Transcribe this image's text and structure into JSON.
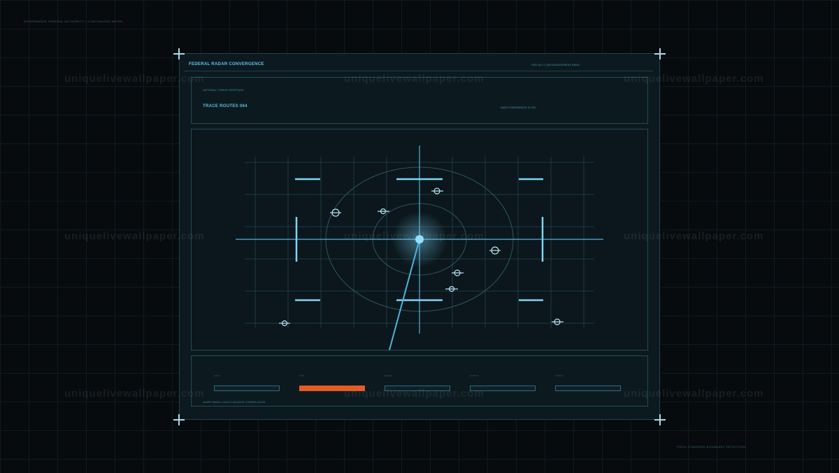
{
  "background": {
    "grid_color": "#1c3038"
  },
  "meta": {
    "top_left_text": "GOVERNANCE FEDERAL AUTHORITY // CONTINUOUS WEIGH",
    "bottom_right_text": "FIELD STANDARD BOUNDARY DETECTION"
  },
  "header": {
    "title": "FEDERAL RADAR CONVERGENCE",
    "right_text": "FED-06 // LOW ENGAGEMENT BAND"
  },
  "top_panel": {
    "small_label": "NATIONAL THREAT APERTURE",
    "trace_label": "TRACE ROUTES 064",
    "confidence": "HIGH CONFIDENCE 97.4%"
  },
  "radar": {
    "sweep_color": "#4fb3dd",
    "center_glow": "#8fe3ff",
    "targets_count": 9
  },
  "bottom_panel": {
    "fields": [
      {
        "label": "INPUT"
      },
      {
        "label": "DATA"
      },
      {
        "label": "METRIC"
      },
      {
        "label": "OUTPUT"
      },
      {
        "label": "STATUS"
      }
    ],
    "active_color": "#e65a25",
    "footer": "ALERT BAND // MULTI-SOURCE CORRELATION"
  },
  "watermark": {
    "text": "uniquelivewallpaper.com"
  }
}
